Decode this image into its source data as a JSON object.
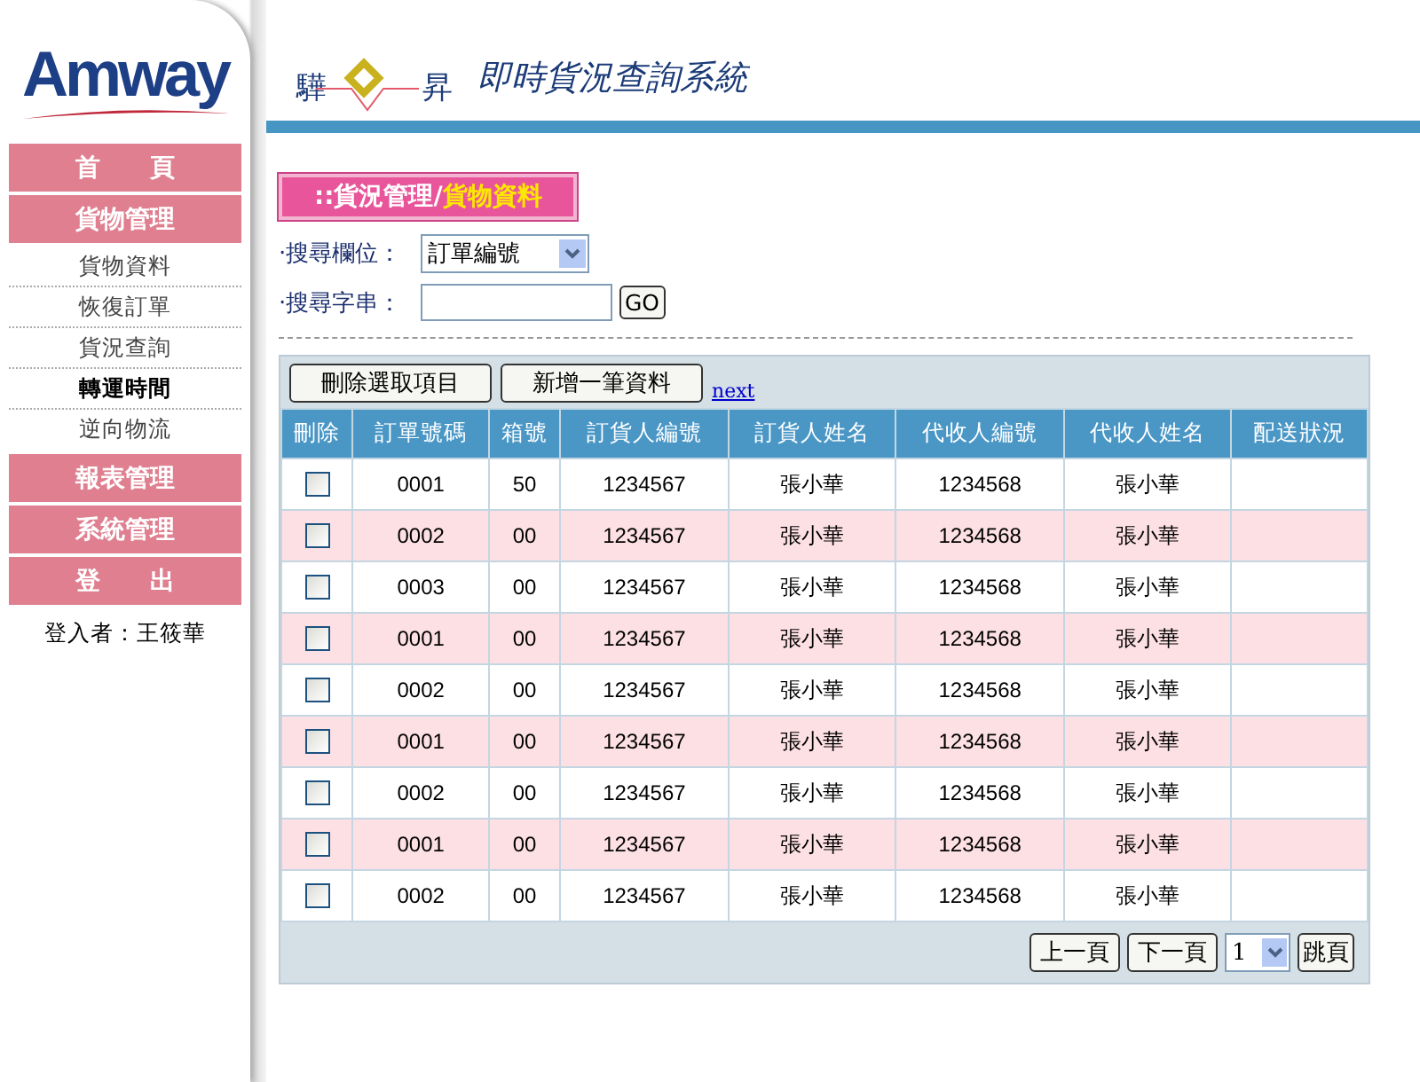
{
  "logo": "Amway",
  "header": {
    "brand_left": "驊",
    "brand_right": "昇",
    "title": "即時貨況查詢系統"
  },
  "sidebar": {
    "items": [
      {
        "kind": "main",
        "label": "首　　頁"
      },
      {
        "kind": "main",
        "label": "貨物管理"
      },
      {
        "kind": "sub",
        "label": "貨物資料",
        "selected": false
      },
      {
        "kind": "sub",
        "label": "恢復訂單",
        "selected": false
      },
      {
        "kind": "sub",
        "label": "貨況查詢",
        "selected": false
      },
      {
        "kind": "sub",
        "label": "轉運時間",
        "selected": true
      },
      {
        "kind": "sub",
        "label": "逆向物流",
        "selected": false
      },
      {
        "kind": "main",
        "label": "報表管理"
      },
      {
        "kind": "main",
        "label": "系統管理"
      },
      {
        "kind": "main",
        "label": "登　　出"
      }
    ],
    "user": "登入者：王筱華"
  },
  "breadcrumb": {
    "prefix": "::",
    "section": "貨況管理/",
    "page": "貨物資料"
  },
  "search": {
    "field_label": "‧搜尋欄位：",
    "field_value": "訂單編號",
    "string_label": "‧搜尋字串：",
    "go": "GO"
  },
  "toolbar": {
    "buttons": [
      "刪除選取項目",
      "新增一筆資料"
    ],
    "next_link": "next"
  },
  "table": {
    "columns": [
      "刪除",
      "訂單號碼",
      "箱號",
      "訂貨人編號",
      "訂貨人姓名",
      "代收人編號",
      "代收人姓名",
      "配送狀況"
    ],
    "rows": [
      {
        "checked": false,
        "cells": [
          "",
          "0001",
          "50",
          "1234567",
          "張小華",
          "1234568",
          "張小華",
          ""
        ]
      },
      {
        "checked": false,
        "cells": [
          "",
          "0002",
          "00",
          "1234567",
          "張小華",
          "1234568",
          "張小華",
          ""
        ]
      },
      {
        "checked": false,
        "cells": [
          "",
          "0003",
          "00",
          "1234567",
          "張小華",
          "1234568",
          "張小華",
          ""
        ]
      },
      {
        "checked": false,
        "cells": [
          "",
          "0001",
          "00",
          "1234567",
          "張小華",
          "1234568",
          "張小華",
          ""
        ]
      },
      {
        "checked": false,
        "cells": [
          "",
          "0002",
          "00",
          "1234567",
          "張小華",
          "1234568",
          "張小華",
          ""
        ]
      },
      {
        "checked": false,
        "cells": [
          "",
          "0001",
          "00",
          "1234567",
          "張小華",
          "1234568",
          "張小華",
          ""
        ]
      },
      {
        "checked": false,
        "cells": [
          "",
          "0002",
          "00",
          "1234567",
          "張小華",
          "1234568",
          "張小華",
          ""
        ]
      },
      {
        "checked": false,
        "cells": [
          "",
          "0001",
          "00",
          "1234567",
          "張小華",
          "1234568",
          "張小華",
          ""
        ]
      },
      {
        "checked": false,
        "cells": [
          "",
          "0002",
          "00",
          "1234567",
          "張小華",
          "1234568",
          "張小華",
          ""
        ]
      }
    ]
  },
  "pager": {
    "prev": "上一頁",
    "next": "下一頁",
    "page": "1",
    "jump": "跳頁"
  }
}
